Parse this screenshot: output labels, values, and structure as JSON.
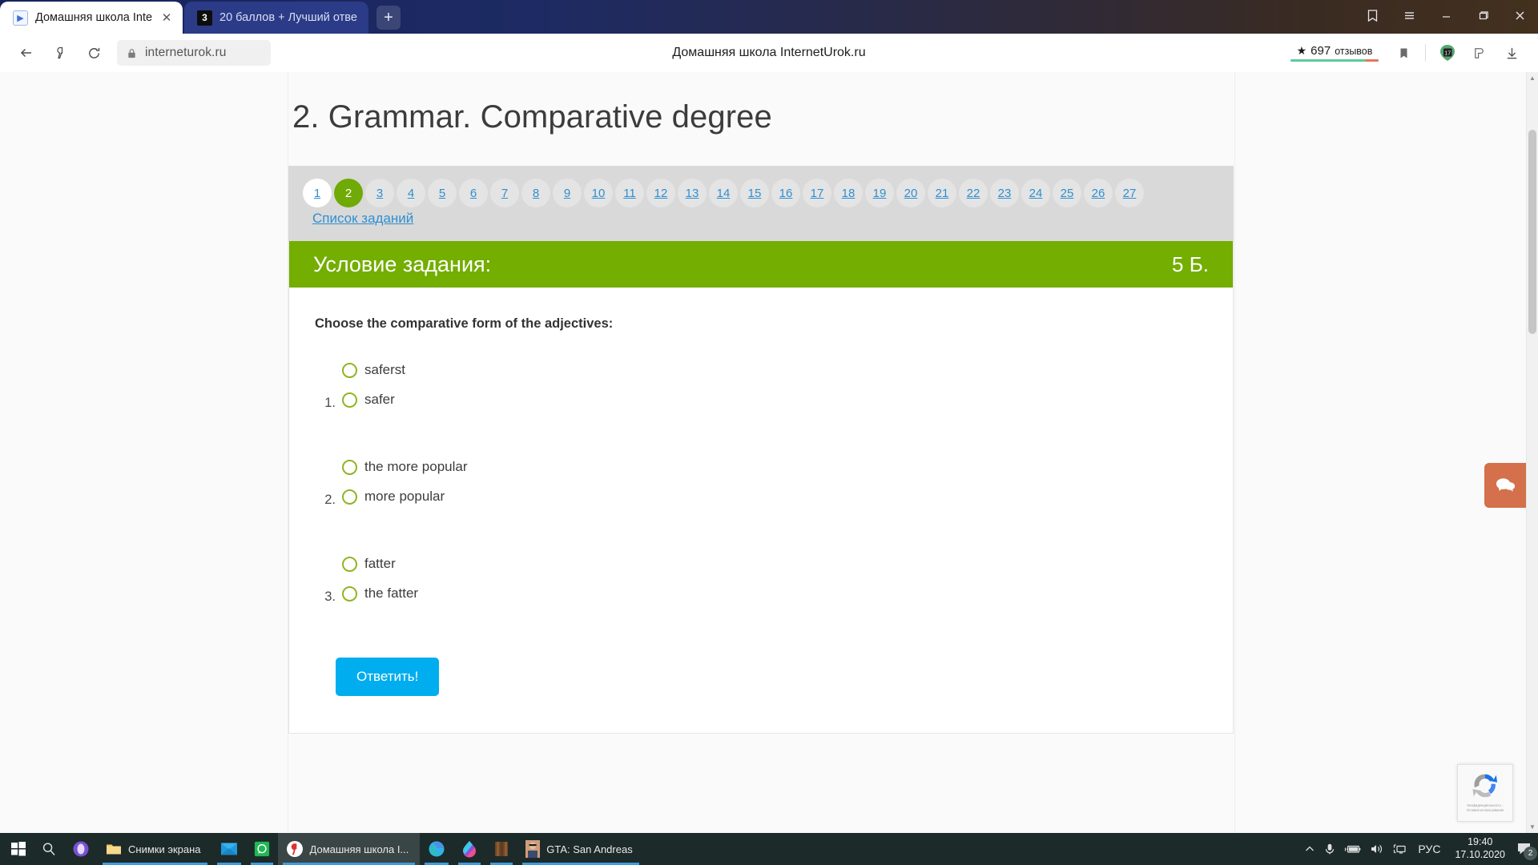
{
  "browser": {
    "tabs": [
      {
        "title": "Домашняя школа Intern",
        "favicon": "play-icon",
        "active": true,
        "badge": ""
      },
      {
        "title": "20 баллов + Лучший отве",
        "favicon": "znanija-icon",
        "active": false,
        "badge": "3"
      }
    ],
    "new_tab_label": "+",
    "window_controls": {
      "collections": "collections-icon",
      "menu": "menu-icon",
      "minimize": "minimize-icon",
      "maximize": "maximize-icon",
      "close": "close-icon"
    },
    "toolbar": {
      "back": "back-arrow-icon",
      "yandex": "yandex-logo-icon",
      "reload": "reload-icon",
      "lock": "lock-icon",
      "url": "interneturok.ru",
      "page_title": "Домашняя школа InternetUrok.ru",
      "reviews_star": "★",
      "reviews_count": "697",
      "reviews_label": "отзывов",
      "bookmark": "bookmark-icon",
      "calendar_day": "17",
      "downloads": "download-icon"
    }
  },
  "page": {
    "title": "2. Grammar. Comparative degree",
    "pager": {
      "items": [
        "1",
        "2",
        "3",
        "4",
        "5",
        "6",
        "7",
        "8",
        "9",
        "10",
        "11",
        "12",
        "13",
        "14",
        "15",
        "16",
        "17",
        "18",
        "19",
        "20",
        "21",
        "22",
        "23",
        "24",
        "25",
        "26",
        "27"
      ],
      "active": "2",
      "visited": [
        "1"
      ],
      "list_link": "Список заданий"
    },
    "task": {
      "header_title": "Условие задания:",
      "score": "5 Б.",
      "prompt": "Choose the comparative form of the adjectives:",
      "groups": [
        {
          "number": "1.",
          "options": [
            "saferst",
            "safer"
          ]
        },
        {
          "number": "2.",
          "options": [
            "the more popular",
            "more popular"
          ]
        },
        {
          "number": "3.",
          "options": [
            "fatter",
            "the fatter"
          ]
        }
      ],
      "submit_label": "Ответить!"
    },
    "chat_widget": "chat-bubbles-icon",
    "recaptcha": {
      "line1": "Конфиденциальность -",
      "line2": "Условия использования"
    }
  },
  "taskbar": {
    "start": "windows-start-icon",
    "search": "search-icon",
    "items": [
      {
        "icon": "cortana-icon",
        "label": ""
      },
      {
        "icon": "folder-icon",
        "label": "Снимки экрана"
      },
      {
        "icon": "mail-icon",
        "label": ""
      },
      {
        "icon": "whatsapp-icon",
        "label": ""
      },
      {
        "icon": "yandex-browser-icon",
        "label": "Домашняя школа I..."
      },
      {
        "icon": "edge-icon",
        "label": ""
      },
      {
        "icon": "paint3d-icon",
        "label": ""
      },
      {
        "icon": "archive-icon",
        "label": ""
      },
      {
        "icon": "gta-icon",
        "label": "GTA: San Andreas"
      }
    ],
    "tray": {
      "expand": "chevron-up-icon",
      "mic": "microphone-icon",
      "battery": "battery-charging-icon",
      "volume": "volume-icon",
      "network": "network-icon",
      "language": "РУС",
      "time": "19:40",
      "date": "17.10.2020",
      "notifications": "notification-icon",
      "notification_count": "2"
    }
  },
  "colors": {
    "green_header": "#73ae00",
    "active_page": "#6faa06",
    "submit_blue": "#00adee",
    "link_blue": "#2f8fd0",
    "chat_orange": "#d4704b"
  }
}
